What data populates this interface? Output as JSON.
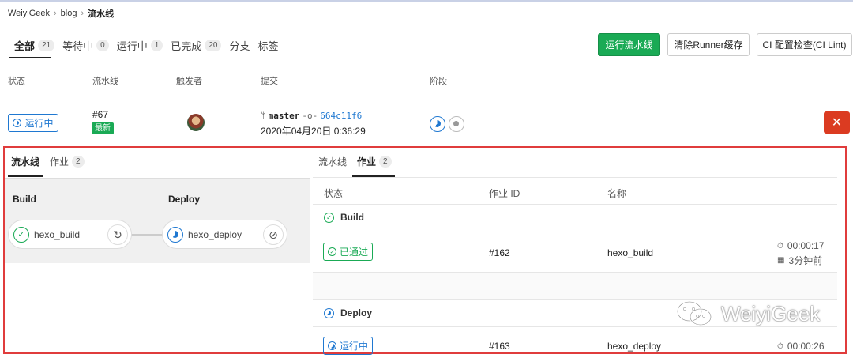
{
  "breadcrumb": {
    "items": [
      "WeiyiGeek",
      "blog",
      "流水线"
    ]
  },
  "tabs": [
    {
      "label": "全部",
      "count": "21"
    },
    {
      "label": "等待中",
      "count": "0"
    },
    {
      "label": "运行中",
      "count": "1"
    },
    {
      "label": "已完成",
      "count": "20"
    },
    {
      "label": "分支",
      "count": ""
    },
    {
      "label": "标签",
      "count": ""
    }
  ],
  "buttons": {
    "run": "运行流水线",
    "clear_cache": "清除Runner缓存",
    "ci_lint": "CI 配置检查(CI Lint)"
  },
  "table_headers": [
    "状态",
    "流水线",
    "触发者",
    "提交",
    "阶段"
  ],
  "pipeline": {
    "status": "运行中",
    "id": "#67",
    "latest": "最新",
    "branch": "master",
    "sha": "664c11f6",
    "time": "2020年04月20日 0:36:29",
    "cancel": "✕"
  },
  "left_panel": {
    "tabs": [
      {
        "label": "流水线",
        "count": ""
      },
      {
        "label": "作业",
        "count": "2"
      }
    ],
    "stages": [
      {
        "title": "Build",
        "job": "hexo_build",
        "action": "↻"
      },
      {
        "title": "Deploy",
        "job": "hexo_deploy",
        "action": "⊘"
      }
    ]
  },
  "right_panel": {
    "tabs": [
      {
        "label": "流水线",
        "count": ""
      },
      {
        "label": "作业",
        "count": "2"
      }
    ],
    "headers": [
      "状态",
      "作业 ID",
      "名称"
    ],
    "sections": [
      {
        "title": "Build",
        "status": "已通过",
        "id": "#162",
        "name": "hexo_build",
        "duration": "00:00:17",
        "ago": "3分钟前"
      },
      {
        "title": "Deploy",
        "status": "运行中",
        "id": "#163",
        "name": "hexo_deploy",
        "duration": "00:00:26",
        "ago": ""
      }
    ]
  },
  "watermark": "WeiyiGeek",
  "colors": {
    "green": "#1aaa55",
    "blue": "#1f78d1",
    "red": "#db3b21",
    "highlight": "#e03c3c"
  }
}
